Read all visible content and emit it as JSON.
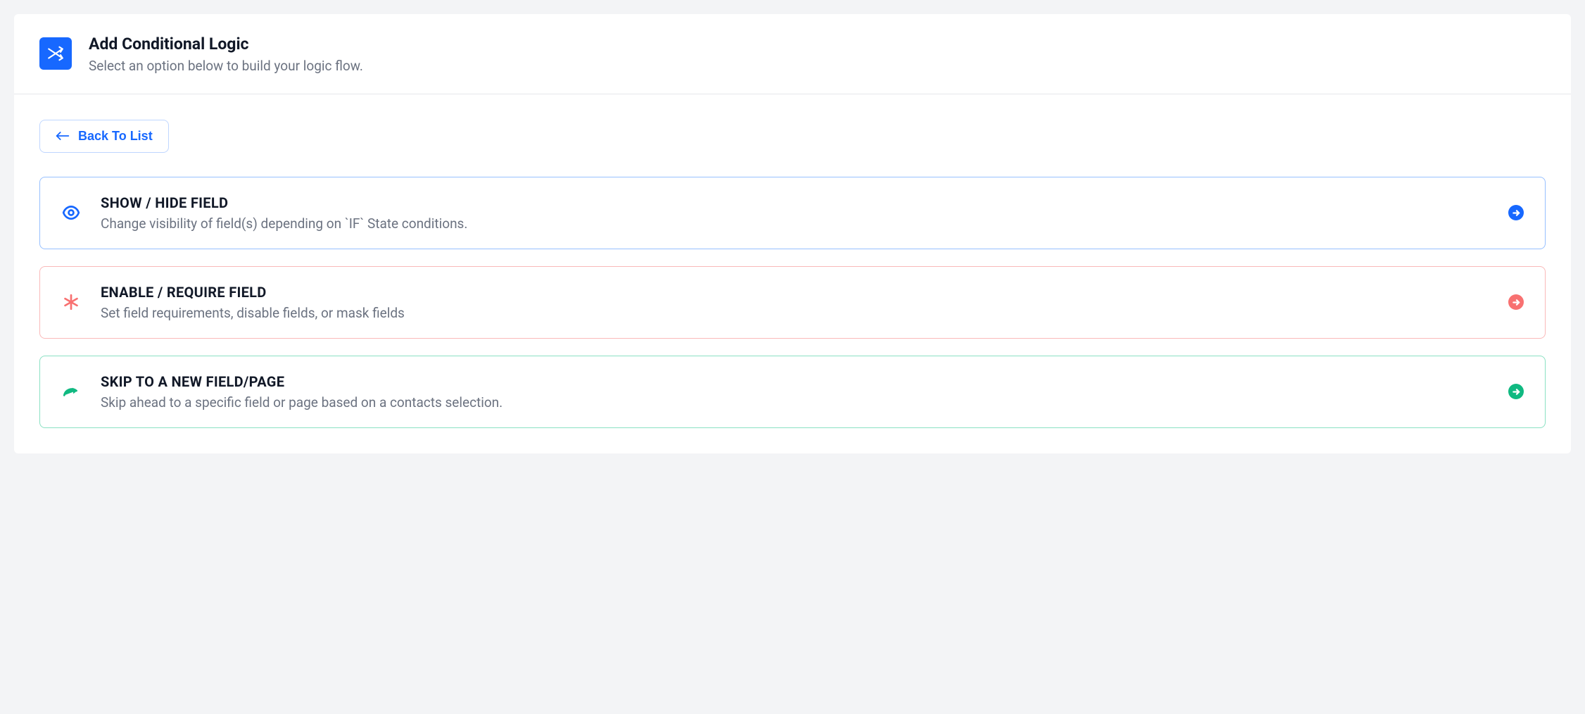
{
  "header": {
    "title": "Add Conditional Logic",
    "subtitle": "Select an option below to build your logic flow."
  },
  "back_button": {
    "label": "Back To List"
  },
  "options": [
    {
      "title": "SHOW / HIDE FIELD",
      "desc": "Change visibility of field(s) depending on `IF` State conditions."
    },
    {
      "title": "ENABLE / REQUIRE FIELD",
      "desc": "Set field requirements, disable fields, or mask fields"
    },
    {
      "title": "SKIP TO A NEW FIELD/PAGE",
      "desc": "Skip ahead to a specific field or page based on a contacts selection."
    }
  ]
}
